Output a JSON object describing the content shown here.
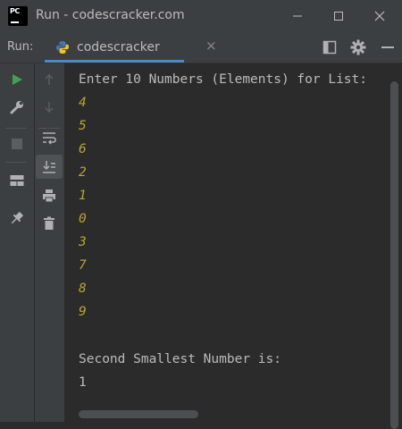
{
  "window": {
    "title": "Run - codescracker.com",
    "logo_text": "PC"
  },
  "toolbar": {
    "run_label": "Run:",
    "tab_label": "codescracker",
    "tab_close": "×"
  },
  "console": {
    "prompt": "Enter 10 Numbers (Elements) for List:",
    "inputs": [
      "4",
      "5",
      "6",
      "2",
      "1",
      "0",
      "3",
      "7",
      "8",
      "9"
    ],
    "result_label": "Second Smallest Number is:",
    "result_value": "1"
  },
  "colors": {
    "accent": "#4a88c7",
    "run_green": "#499c54",
    "input_yellow": "#bba529",
    "text": "#bbbbbb"
  },
  "icons": {
    "gutter_left": [
      "run-icon",
      "wrench-icon",
      "stop-icon",
      "layout-icon",
      "pin-icon"
    ],
    "gutter_right": [
      "up-arrow-icon",
      "down-arrow-icon",
      "soft-wrap-icon",
      "scroll-to-end-icon",
      "print-icon",
      "trash-icon"
    ],
    "toolbar": [
      "python-icon",
      "layout-panel-icon",
      "settings-gear-icon",
      "hide-icon"
    ]
  }
}
